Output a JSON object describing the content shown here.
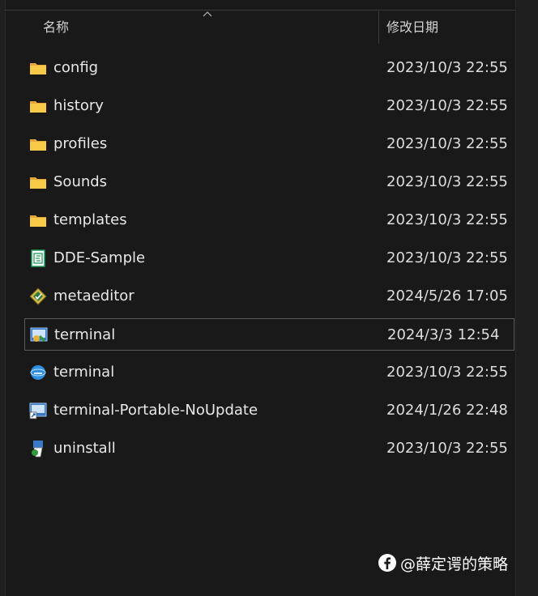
{
  "header": {
    "name_col": "名称",
    "date_col": "修改日期"
  },
  "files": [
    {
      "name": "config",
      "modified": "2023/10/3 22:55",
      "icon": "folder-icon"
    },
    {
      "name": "history",
      "modified": "2023/10/3 22:55",
      "icon": "folder-icon"
    },
    {
      "name": "profiles",
      "modified": "2023/10/3 22:55",
      "icon": "folder-icon"
    },
    {
      "name": "Sounds",
      "modified": "2023/10/3 22:55",
      "icon": "folder-icon"
    },
    {
      "name": "templates",
      "modified": "2023/10/3 22:55",
      "icon": "folder-icon"
    },
    {
      "name": "DDE-Sample",
      "modified": "2023/10/3 22:55",
      "icon": "spreadsheet-icon"
    },
    {
      "name": "metaeditor",
      "modified": "2024/5/26 17:05",
      "icon": "metaeditor-icon"
    },
    {
      "name": "terminal",
      "modified": "2024/3/3 12:54",
      "icon": "terminal-app-icon",
      "selected": true
    },
    {
      "name": "terminal",
      "modified": "2023/10/3 22:55",
      "icon": "globe-icon"
    },
    {
      "name": "terminal-Portable-NoUpdate",
      "modified": "2024/1/26 22:48",
      "icon": "shortcut-icon"
    },
    {
      "name": "uninstall",
      "modified": "2023/10/3 22:55",
      "icon": "uninstall-icon"
    }
  ],
  "watermark": {
    "text": "@薛定谔的策略"
  },
  "colors": {
    "background": "#191919",
    "folder": "#f7c948",
    "selection_border": "#5a5a5a"
  }
}
